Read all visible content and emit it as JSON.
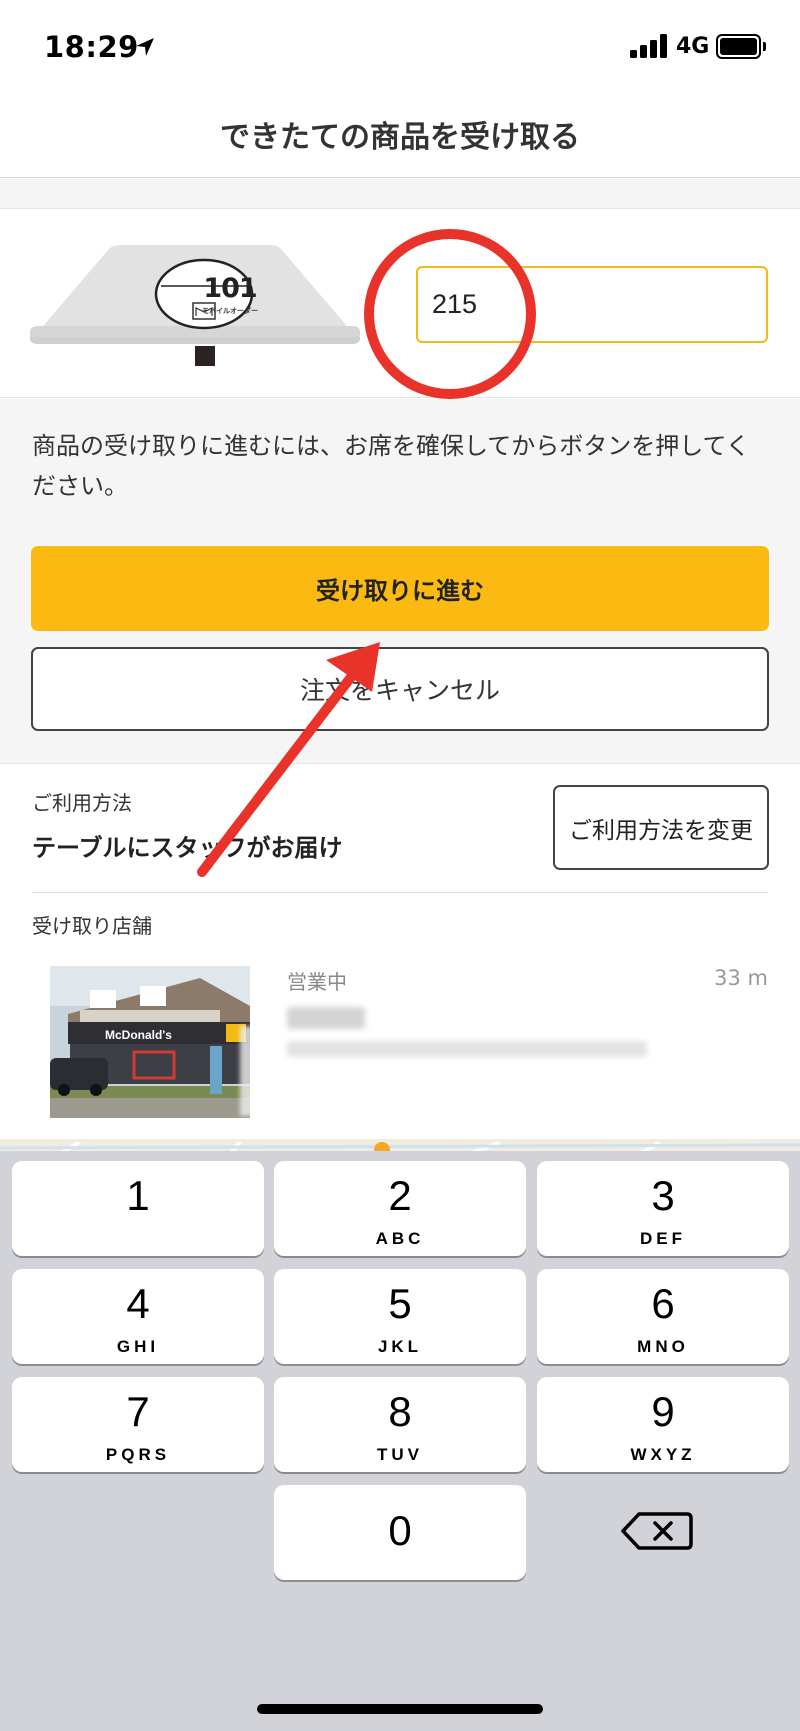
{
  "status_bar": {
    "time": "18:29",
    "network": "4G"
  },
  "header": {
    "title": "できたての商品を受け取る"
  },
  "table_stand": {
    "number": "101",
    "caption": "モバイルオーダー"
  },
  "table_number_input": {
    "value": "215"
  },
  "instructions": "商品の受け取りに進むには、お席を確保してからボタンを押してください。",
  "buttons": {
    "proceed": "受け取りに進む",
    "cancel": "注文をキャンセル"
  },
  "usage": {
    "label": "ご利用方法",
    "value": "テーブルにスタッフがお届け",
    "change_button": "ご利用方法を変更"
  },
  "store": {
    "label": "受け取り店舗",
    "status": "営業中",
    "distance": "33 m",
    "sign_text": "McDonald's"
  },
  "keypad": {
    "keys": [
      {
        "digit": "1",
        "letters": ""
      },
      {
        "digit": "2",
        "letters": "ABC"
      },
      {
        "digit": "3",
        "letters": "DEF"
      },
      {
        "digit": "4",
        "letters": "GHI"
      },
      {
        "digit": "5",
        "letters": "JKL"
      },
      {
        "digit": "6",
        "letters": "MNO"
      },
      {
        "digit": "7",
        "letters": "PQRS"
      },
      {
        "digit": "8",
        "letters": "TUV"
      },
      {
        "digit": "9",
        "letters": "WXYZ"
      },
      {
        "digit": "0",
        "letters": ""
      }
    ]
  },
  "colors": {
    "accent": "#fbba12",
    "annotation": "#e8322a",
    "keyboard_bg": "#d1d3d9"
  },
  "icons": {
    "location": "location-arrow-icon",
    "delete": "delete-backspace-icon"
  }
}
